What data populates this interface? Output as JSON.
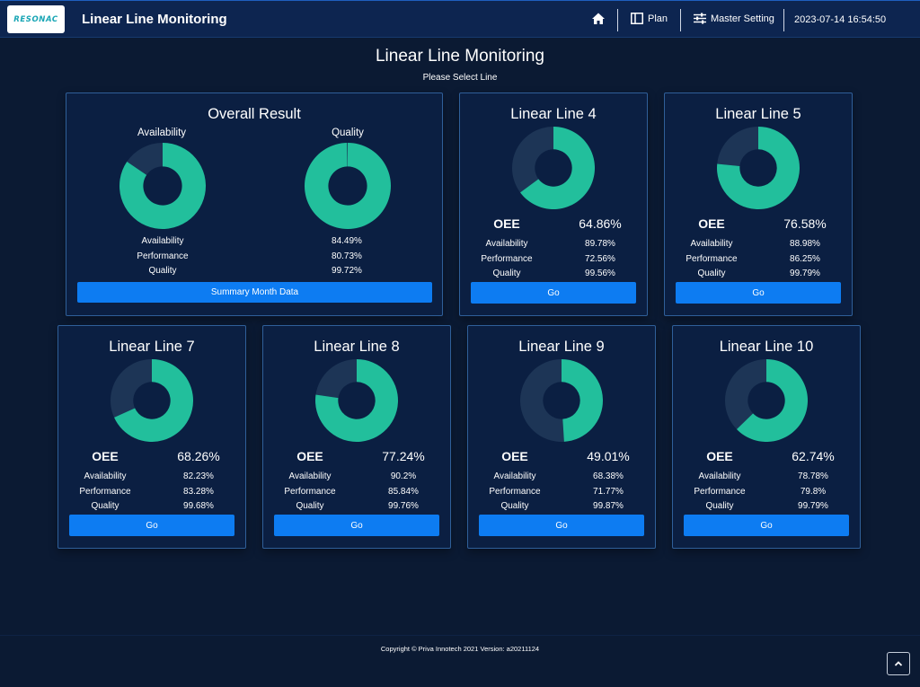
{
  "header": {
    "logo_text": "RESONAC",
    "title": "Linear Line Monitoring",
    "home_icon": "home-icon",
    "nav": [
      {
        "label": "Plan",
        "icon": "layout-columns-icon"
      },
      {
        "label": "Master Setting",
        "icon": "sliders-icon"
      }
    ],
    "datetime": "2023-07-14 16:54:50"
  },
  "page": {
    "title": "Linear Line Monitoring",
    "subtitle": "Please Select Line"
  },
  "colors": {
    "donut_fill": "#22bf9c",
    "donut_rest": "#1d3556",
    "button": "#0d7cf2",
    "background": "#0b1a33"
  },
  "overall": {
    "title": "Overall Result",
    "availability_chart_label": "Availability",
    "quality_chart_label": "Quality",
    "availability_fraction": 0.8449,
    "quality_fraction": 0.9972,
    "metrics": [
      {
        "label": "Availability",
        "value": "84.49%"
      },
      {
        "label": "Performance",
        "value": "80.73%"
      },
      {
        "label": "Quality",
        "value": "99.72%"
      }
    ],
    "button_label": "Summary Month Data"
  },
  "oee_label": "OEE",
  "go_label": "Go",
  "metric_labels": [
    "Availability",
    "Performance",
    "Quality"
  ],
  "lines": [
    {
      "name": "Linear Line 4",
      "oee": "64.86%",
      "oee_fraction": 0.6486,
      "availability": "89.78%",
      "performance": "72.56%",
      "quality": "99.56%"
    },
    {
      "name": "Linear Line 5",
      "oee": "76.58%",
      "oee_fraction": 0.7658,
      "availability": "88.98%",
      "performance": "86.25%",
      "quality": "99.79%"
    },
    {
      "name": "Linear Line 7",
      "oee": "68.26%",
      "oee_fraction": 0.6826,
      "availability": "82.23%",
      "performance": "83.28%",
      "quality": "99.68%"
    },
    {
      "name": "Linear Line 8",
      "oee": "77.24%",
      "oee_fraction": 0.7724,
      "availability": "90.2%",
      "performance": "85.84%",
      "quality": "99.76%"
    },
    {
      "name": "Linear Line 9",
      "oee": "49.01%",
      "oee_fraction": 0.4901,
      "availability": "68.38%",
      "performance": "71.77%",
      "quality": "99.87%"
    },
    {
      "name": "Linear Line 10",
      "oee": "62.74%",
      "oee_fraction": 0.6274,
      "availability": "78.78%",
      "performance": "79.8%",
      "quality": "99.79%"
    }
  ],
  "footer": {
    "copyright": "Copyright © Priva Innotech 2021 Version: a20211124",
    "scroll_top_icon": "chevron-up-icon"
  }
}
